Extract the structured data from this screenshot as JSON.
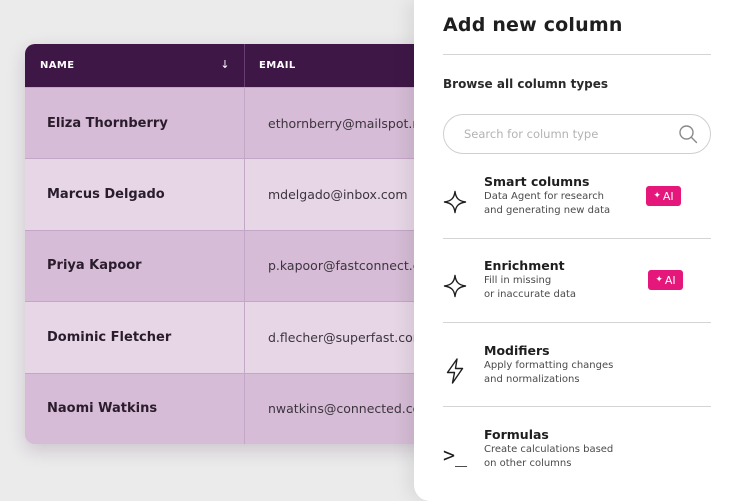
{
  "table": {
    "columns": {
      "name": "NAME",
      "email": "EMAIL",
      "sort_glyph": "↓"
    },
    "rows": [
      {
        "name": "Eliza Thornberry",
        "email": "ethornberry@mailspot.net"
      },
      {
        "name": "Marcus Delgado",
        "email": "mdelgado@inbox.com"
      },
      {
        "name": "Priya Kapoor",
        "email": "p.kapoor@fastconnect.com"
      },
      {
        "name": "Dominic Fletcher",
        "email": "d.flecher@superfast.com"
      },
      {
        "name": "Naomi Watkins",
        "email": "nwatkins@connected.com"
      }
    ]
  },
  "panel": {
    "title": "Add new column",
    "browse_label": "Browse all column types",
    "search": {
      "placeholder": "Search for column type",
      "icon": "search-icon"
    },
    "types": [
      {
        "title": "Smart columns",
        "desc_line1": "Data Agent for research",
        "desc_line2": "and generating new data",
        "icon": "sparkle-icon",
        "badge": "AI"
      },
      {
        "title": "Enrichment",
        "desc_line1": "Fill in missing",
        "desc_line2": "or inaccurate data",
        "icon": "sparkle-icon",
        "badge": "AI"
      },
      {
        "title": "Modifiers",
        "desc_line1": "Apply formatting changes",
        "desc_line2": "and normalizations",
        "icon": "lightning-icon"
      },
      {
        "title": "Formulas",
        "desc_line1": "Create calculations based",
        "desc_line2": "on other columns",
        "icon": "terminal-prompt-icon",
        "glyph": ">_"
      }
    ]
  },
  "colors": {
    "header_bg": "#3f1747",
    "row_dark": "#d6bcd6",
    "row_light": "#e6d6e6",
    "ai_badge": "#e6177a"
  }
}
